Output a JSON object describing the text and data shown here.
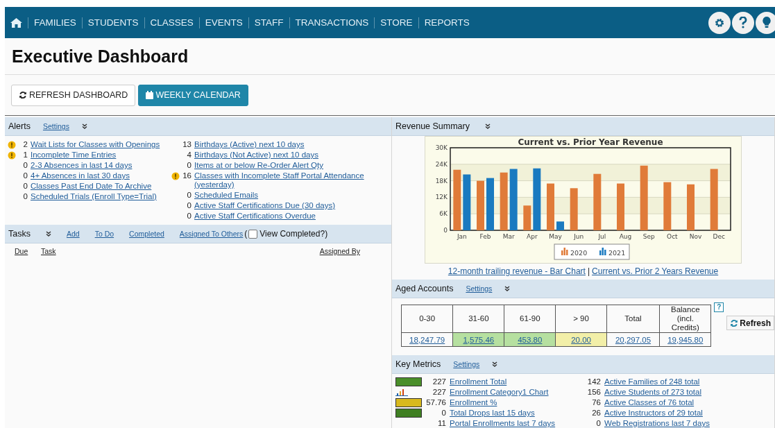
{
  "nav": {
    "items": [
      "FAMILIES",
      "STUDENTS",
      "CLASSES",
      "EVENTS",
      "STAFF",
      "TRANSACTIONS",
      "STORE",
      "REPORTS"
    ]
  },
  "title": "Executive Dashboard",
  "toolbar": {
    "buttons": [
      {
        "label": "REFRESH DASHBOARD",
        "kind": "refresh"
      },
      {
        "label": "WEEKLY CALENDAR",
        "kind": "calendar"
      }
    ]
  },
  "alerts": {
    "title": "Alerts",
    "settings": "Settings",
    "columns": [
      [
        {
          "count": "2",
          "label": "Wait Lists for Classes with Openings",
          "warning": true
        },
        {
          "count": "1",
          "label": "Incomplete Time Entries",
          "warning": true
        },
        {
          "count": "0",
          "label": "2-3 Absences in last 14 days",
          "warning": false
        },
        {
          "count": "0",
          "label": "4+ Absences in last 30 days",
          "warning": false
        },
        {
          "count": "0",
          "label": "Classes Past End Date To Archive",
          "warning": false
        },
        {
          "count": "0",
          "label": "Scheduled Trials (Enroll Type=Trial)",
          "warning": false
        }
      ],
      [
        {
          "count": "13",
          "label": "Birthdays (Active) next 10 days",
          "warning": false
        },
        {
          "count": "4",
          "label": "Birthdays (Not Active) next 10 days",
          "warning": false
        },
        {
          "count": "0",
          "label": "Items at or below Re-Order Alert Qty",
          "warning": false
        },
        {
          "count": "16",
          "label": "Classes with Incomplete Staff Portal Attendance (yesterday)",
          "warning": true
        },
        {
          "count": "0",
          "label": "Scheduled Emails",
          "warning": false
        },
        {
          "count": "0",
          "label": "Active Staff Certifications Due (30 days)",
          "warning": false
        },
        {
          "count": "0",
          "label": "Active Staff Certifications Overdue",
          "warning": false
        }
      ]
    ]
  },
  "tasks": {
    "title": "Tasks",
    "links": [
      "Add",
      "To Do",
      "Completed",
      "Assigned To Others"
    ],
    "open_paren": "(",
    "view_completed": {
      "label": "View Completed?)",
      "checked": false
    },
    "columns": [
      "Due",
      "Task",
      "Assigned By"
    ]
  },
  "revenue": {
    "title": "Revenue Summary",
    "chart_data": {
      "type": "bar",
      "title": "Current vs. Prior Year Revenue",
      "categories": [
        "Jan",
        "Feb",
        "Mar",
        "Apr",
        "May",
        "Jun",
        "Jul",
        "Aug",
        "Sep",
        "Oct",
        "Nov",
        "Dec"
      ],
      "series": [
        {
          "name": "2020",
          "color": "#e07b39",
          "values": [
            22000,
            18000,
            21000,
            9000,
            17000,
            15300,
            20500,
            17000,
            23500,
            17500,
            16700,
            22300
          ]
        },
        {
          "name": "2021",
          "color": "#1a7ac0",
          "values": [
            20300,
            19000,
            22300,
            22500,
            3200,
            null,
            null,
            null,
            null,
            null,
            null,
            null
          ]
        }
      ],
      "grid": true,
      "legend": true,
      "ylim": [
        0,
        30000
      ],
      "yticks": [
        {
          "value": 0,
          "label": "0"
        },
        {
          "value": 6000,
          "label": "6K"
        },
        {
          "value": 12000,
          "label": "12K"
        },
        {
          "value": 18000,
          "label": "18K"
        },
        {
          "value": 24000,
          "label": "24K"
        },
        {
          "value": 30000,
          "label": "30K"
        }
      ]
    },
    "links": [
      "12-month trailing revenue - Bar Chart",
      "Current vs. Prior 2 Years Revenue"
    ],
    "separator": "|"
  },
  "aged": {
    "title": "Aged Accounts",
    "settings": "Settings",
    "headers": [
      "0-30",
      "31-60",
      "61-90",
      "> 90",
      "Total",
      "Balance (incl. Credits)"
    ],
    "values": [
      {
        "text": "18,247.79"
      },
      {
        "text": "1,575.46",
        "color": "#b6e0a0"
      },
      {
        "text": "453.80",
        "color": "#b6e0a0"
      },
      {
        "text": "20.00",
        "color": "#f2efa8"
      },
      {
        "text": "20,297.05"
      },
      {
        "text": "19,945.80"
      }
    ],
    "help": "?",
    "refresh": "Refresh"
  },
  "metrics": {
    "title": "Key Metrics",
    "settings": "Settings",
    "left": [
      {
        "count": "227",
        "label": "Enrollment Total",
        "kind": "swatch",
        "color": "#4a8f2a"
      },
      {
        "count": "227",
        "label": "Enrollment Category1 Chart",
        "kind": "chart"
      },
      {
        "count": "57.76",
        "label": "Enrollment %",
        "kind": "swatch",
        "color": "#d8b91e"
      },
      {
        "count": "0",
        "label": "Total Drops last 15 days",
        "kind": "swatch",
        "color": "#3f7f22"
      },
      {
        "count": "11",
        "label": "Portal Enrollments last 7 days",
        "kind": "none"
      }
    ],
    "right": [
      {
        "count": "142",
        "label": "Active Families of 248 total"
      },
      {
        "count": "156",
        "label": "Active Students of 273 total"
      },
      {
        "count": "76",
        "label": "Active Classes of 76 total"
      },
      {
        "count": "26",
        "label": "Active Instructors of 29 total"
      },
      {
        "count": "0",
        "label": "Web Registrations last 7 days"
      }
    ]
  }
}
